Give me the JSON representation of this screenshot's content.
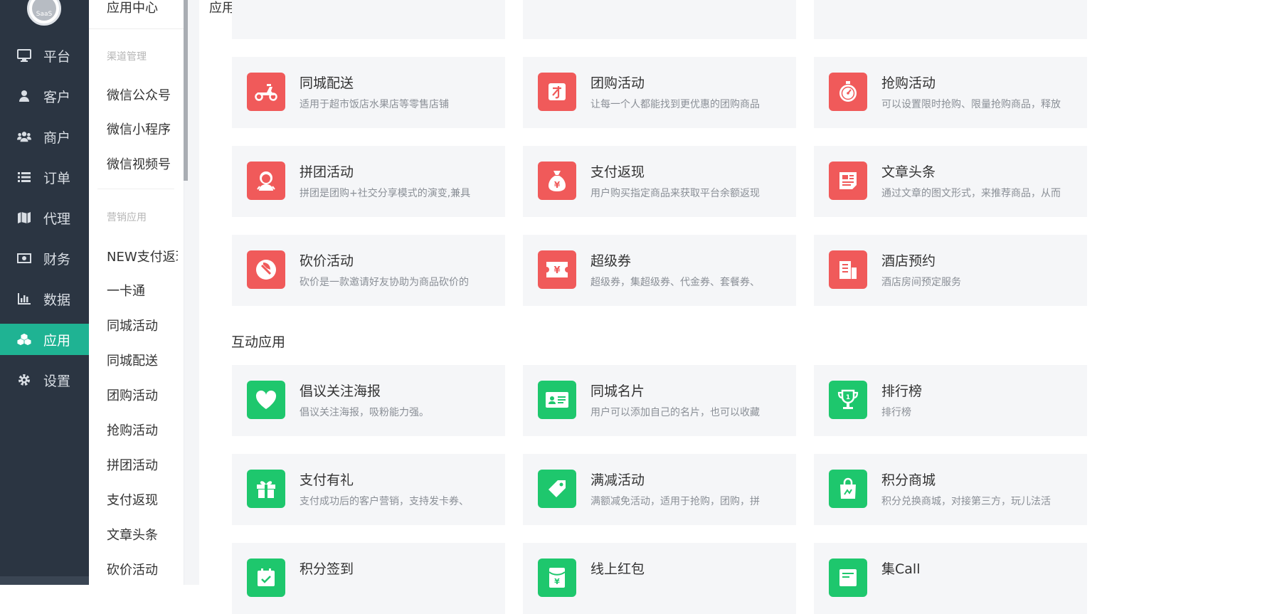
{
  "logo": {
    "text": "SaaS"
  },
  "nav": [
    {
      "label": "平台",
      "icon": "monitor-icon"
    },
    {
      "label": "客户",
      "icon": "user-icon"
    },
    {
      "label": "商户",
      "icon": "users-icon"
    },
    {
      "label": "订单",
      "icon": "list-icon"
    },
    {
      "label": "代理",
      "icon": "map-icon"
    },
    {
      "label": "财务",
      "icon": "money-icon"
    },
    {
      "label": "数据",
      "icon": "bar-chart-icon"
    },
    {
      "label": "应用",
      "icon": "cubes-icon",
      "active": true
    },
    {
      "label": "设置",
      "icon": "gear-icon"
    }
  ],
  "submenu": {
    "title": "应用中心",
    "group1": "渠道管理",
    "channel_items": [
      "微信公众号",
      "微信小程序",
      "微信视频号"
    ],
    "group2": "营销应用",
    "marketing_items": [
      "NEW支付返现",
      "一卡通",
      "同城活动",
      "同城配送",
      "团购活动",
      "抢购活动",
      "拼团活动",
      "支付返现",
      "文章头条",
      "砍价活动"
    ]
  },
  "main": {
    "page_title": "应用插件库",
    "marketing_cards": [
      {
        "title": "同城配送",
        "desc": "适用于超市饭店水果店等零售店铺",
        "icon": "scooter-icon"
      },
      {
        "title": "团购活动",
        "desc": "让每一个人都能找到更优惠的团购商品",
        "icon": "group-buy-icon"
      },
      {
        "title": "抢购活动",
        "desc": "可以设置限时抢购、限量抢购商品，释放",
        "icon": "stopwatch-icon"
      },
      {
        "title": "拼团活动",
        "desc": "拼团是团购+社交分享模式的演变,兼具",
        "icon": "pin-group-icon"
      },
      {
        "title": "支付返现",
        "desc": "用户购买指定商品来获取平台余额返现",
        "icon": "money-bag-icon"
      },
      {
        "title": "文章头条",
        "desc": "通过文章的图文形式，来推荐商品，从而",
        "icon": "article-icon"
      },
      {
        "title": "砍价活动",
        "desc": "砍价是一款邀请好友协助为商品砍价的",
        "icon": "axe-icon"
      },
      {
        "title": "超级券",
        "desc": "超级券，集超级券、代金券、套餐券、",
        "icon": "ticket-icon"
      },
      {
        "title": "酒店预约",
        "desc": "酒店房间预定服务",
        "icon": "hotel-icon"
      }
    ],
    "interactive_title": "互动应用",
    "interactive_cards": [
      {
        "title": "倡议关注海报",
        "desc": "倡议关注海报，吸粉能力强。",
        "icon": "heart-icon"
      },
      {
        "title": "同城名片",
        "desc": "用户可以添加自己的名片，也可以收藏",
        "icon": "id-card-icon"
      },
      {
        "title": "排行榜",
        "desc": "排行榜",
        "icon": "trophy-icon"
      },
      {
        "title": "支付有礼",
        "desc": "支付成功后的客户营销，支持发卡券、",
        "icon": "gift-icon"
      },
      {
        "title": "满减活动",
        "desc": "满额减免活动，适用于抢购，团购，拼",
        "icon": "tag-icon"
      },
      {
        "title": "积分商城",
        "desc": "积分兑换商城，对接第三方，玩儿法活",
        "icon": "shopping-bag-icon"
      },
      {
        "title": "积分签到",
        "desc": "",
        "icon": "calendar-check-icon"
      },
      {
        "title": "线上红包",
        "desc": "",
        "icon": "red-envelope-icon"
      },
      {
        "title": "集Call",
        "desc": "",
        "icon": "board-icon"
      }
    ]
  }
}
